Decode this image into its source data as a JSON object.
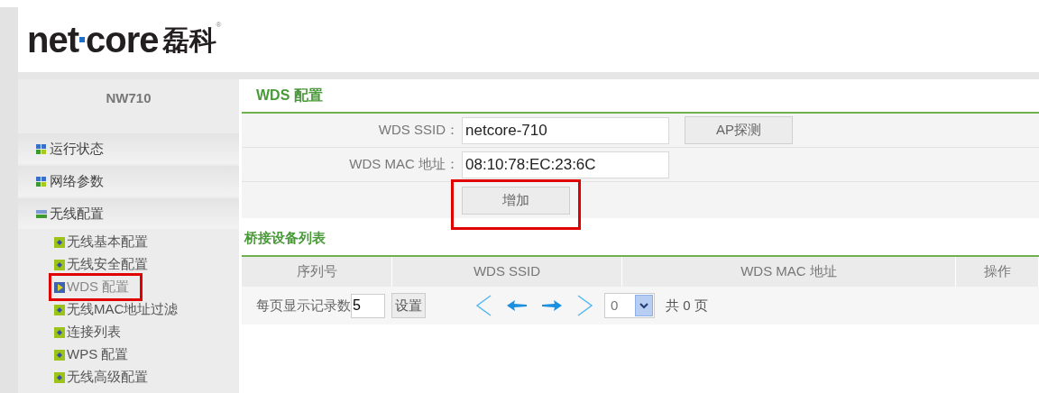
{
  "logo": {
    "word_left": "net",
    "word_right": "core",
    "chinese": "磊科",
    "mark": "®"
  },
  "sidebar": {
    "model": "NW710",
    "groups": [
      {
        "label": "运行状态",
        "expanded": false
      },
      {
        "label": "网络参数",
        "expanded": false
      },
      {
        "label": "无线配置",
        "expanded": true,
        "children": [
          {
            "label": "无线基本配置",
            "selected": false,
            "highlighted": false
          },
          {
            "label": "无线安全配置",
            "selected": false,
            "highlighted": false
          },
          {
            "label": "WDS 配置",
            "selected": true,
            "highlighted": true
          },
          {
            "label": "无线MAC地址过滤",
            "selected": false,
            "highlighted": false
          },
          {
            "label": "连接列表",
            "selected": false,
            "highlighted": false
          },
          {
            "label": "WPS 配置",
            "selected": false,
            "highlighted": false
          },
          {
            "label": "无线高级配置",
            "selected": false,
            "highlighted": false
          }
        ]
      }
    ]
  },
  "main": {
    "section_title": "WDS 配置",
    "fields": [
      {
        "label": "WDS SSID：",
        "value": "netcore-710",
        "button": "AP探测"
      },
      {
        "label": "WDS MAC 地址：",
        "value": "08:10:78:EC:23:6C"
      }
    ],
    "add_button": {
      "label": "增加",
      "highlighted": true
    },
    "list_title": "桥接设备列表",
    "table": {
      "columns": [
        "序列号",
        "WDS SSID",
        "WDS MAC 地址",
        "操作"
      ]
    },
    "pager": {
      "per_page_label": "每页显示记录数",
      "per_page_value": "5",
      "set_button": "设置",
      "page_value": "0",
      "total": "共 0 页"
    }
  }
}
